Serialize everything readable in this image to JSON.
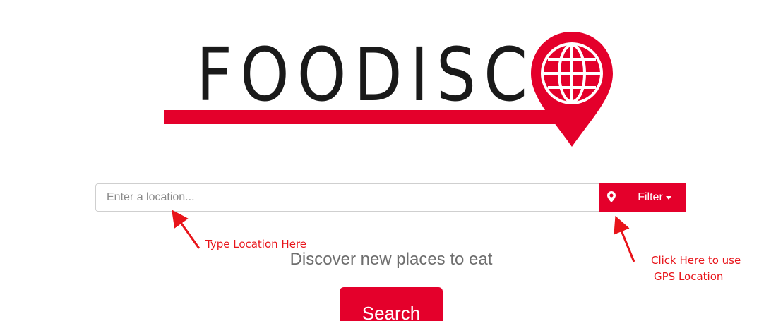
{
  "logo": {
    "text": "FOODISC",
    "brand_color": "#e4002b",
    "text_color": "#1a1a1a",
    "icon": "globe-pin-icon"
  },
  "search": {
    "placeholder": "Enter a location...",
    "value": ""
  },
  "gps_button": {
    "icon": "map-marker-icon"
  },
  "filter_button": {
    "label": "Filter",
    "icon": "caret-down-icon"
  },
  "tagline": "Discover new places to eat",
  "search_button": {
    "label": "Search"
  },
  "annotations": {
    "type_location": "Type Location Here",
    "gps_line1": "Click Here to use",
    "gps_line2": "GPS Location",
    "color": "#e8141a"
  }
}
